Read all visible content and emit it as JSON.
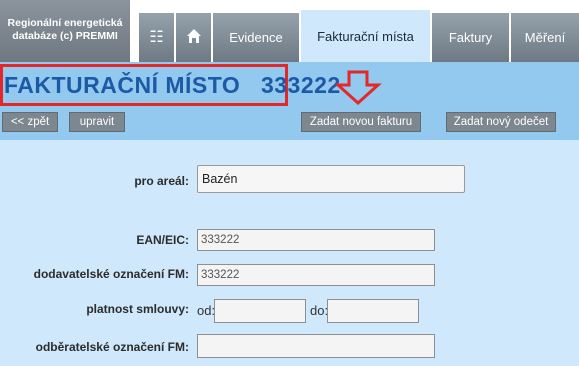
{
  "brand": {
    "line1": "Regionální energetická",
    "line2": "databáze (c) PREMMI"
  },
  "nav": {
    "menu_icon": "☷",
    "home_icon": "🏠",
    "tabs": [
      {
        "label": "Evidence"
      },
      {
        "label": "Fakturační místa"
      },
      {
        "label": "Faktury"
      },
      {
        "label": "Měření"
      }
    ]
  },
  "header": {
    "title": "FAKTURAČNÍ MÍSTO   333222",
    "back_label": "<< zpět",
    "edit_label": "upravit",
    "new_invoice_label": "Zadat novou fakturu",
    "new_reading_label": "Zadat nový odečet",
    "annotation_colors": {
      "frame": "#e3282a",
      "arrow": "#e3282a"
    }
  },
  "form": {
    "areal_label": "pro areál:",
    "areal_value": "Bazén",
    "ean_label": "EAN/EIC:",
    "ean_value": "333222",
    "supplier_label": "dodavatelské označení FM:",
    "supplier_value": "333222",
    "validity_label": "platnost smlouvy:",
    "from_label": "od:",
    "from_value": "",
    "to_label": "do:",
    "to_value": "",
    "customer_label": "odběratelské označení FM:",
    "customer_value": ""
  }
}
